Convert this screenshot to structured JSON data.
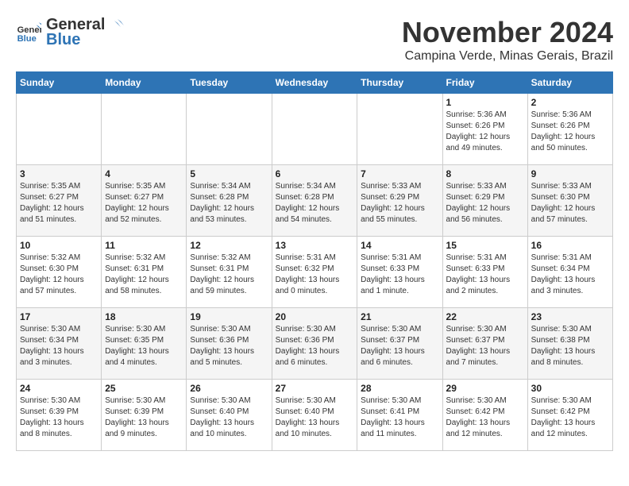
{
  "header": {
    "logo_line1": "General",
    "logo_line2": "Blue",
    "month": "November 2024",
    "location": "Campina Verde, Minas Gerais, Brazil"
  },
  "weekdays": [
    "Sunday",
    "Monday",
    "Tuesday",
    "Wednesday",
    "Thursday",
    "Friday",
    "Saturday"
  ],
  "weeks": [
    [
      {
        "day": "",
        "info": ""
      },
      {
        "day": "",
        "info": ""
      },
      {
        "day": "",
        "info": ""
      },
      {
        "day": "",
        "info": ""
      },
      {
        "day": "",
        "info": ""
      },
      {
        "day": "1",
        "info": "Sunrise: 5:36 AM\nSunset: 6:26 PM\nDaylight: 12 hours and 49 minutes."
      },
      {
        "day": "2",
        "info": "Sunrise: 5:36 AM\nSunset: 6:26 PM\nDaylight: 12 hours and 50 minutes."
      }
    ],
    [
      {
        "day": "3",
        "info": "Sunrise: 5:35 AM\nSunset: 6:27 PM\nDaylight: 12 hours and 51 minutes."
      },
      {
        "day": "4",
        "info": "Sunrise: 5:35 AM\nSunset: 6:27 PM\nDaylight: 12 hours and 52 minutes."
      },
      {
        "day": "5",
        "info": "Sunrise: 5:34 AM\nSunset: 6:28 PM\nDaylight: 12 hours and 53 minutes."
      },
      {
        "day": "6",
        "info": "Sunrise: 5:34 AM\nSunset: 6:28 PM\nDaylight: 12 hours and 54 minutes."
      },
      {
        "day": "7",
        "info": "Sunrise: 5:33 AM\nSunset: 6:29 PM\nDaylight: 12 hours and 55 minutes."
      },
      {
        "day": "8",
        "info": "Sunrise: 5:33 AM\nSunset: 6:29 PM\nDaylight: 12 hours and 56 minutes."
      },
      {
        "day": "9",
        "info": "Sunrise: 5:33 AM\nSunset: 6:30 PM\nDaylight: 12 hours and 57 minutes."
      }
    ],
    [
      {
        "day": "10",
        "info": "Sunrise: 5:32 AM\nSunset: 6:30 PM\nDaylight: 12 hours and 57 minutes."
      },
      {
        "day": "11",
        "info": "Sunrise: 5:32 AM\nSunset: 6:31 PM\nDaylight: 12 hours and 58 minutes."
      },
      {
        "day": "12",
        "info": "Sunrise: 5:32 AM\nSunset: 6:31 PM\nDaylight: 12 hours and 59 minutes."
      },
      {
        "day": "13",
        "info": "Sunrise: 5:31 AM\nSunset: 6:32 PM\nDaylight: 13 hours and 0 minutes."
      },
      {
        "day": "14",
        "info": "Sunrise: 5:31 AM\nSunset: 6:33 PM\nDaylight: 13 hours and 1 minute."
      },
      {
        "day": "15",
        "info": "Sunrise: 5:31 AM\nSunset: 6:33 PM\nDaylight: 13 hours and 2 minutes."
      },
      {
        "day": "16",
        "info": "Sunrise: 5:31 AM\nSunset: 6:34 PM\nDaylight: 13 hours and 3 minutes."
      }
    ],
    [
      {
        "day": "17",
        "info": "Sunrise: 5:30 AM\nSunset: 6:34 PM\nDaylight: 13 hours and 3 minutes."
      },
      {
        "day": "18",
        "info": "Sunrise: 5:30 AM\nSunset: 6:35 PM\nDaylight: 13 hours and 4 minutes."
      },
      {
        "day": "19",
        "info": "Sunrise: 5:30 AM\nSunset: 6:36 PM\nDaylight: 13 hours and 5 minutes."
      },
      {
        "day": "20",
        "info": "Sunrise: 5:30 AM\nSunset: 6:36 PM\nDaylight: 13 hours and 6 minutes."
      },
      {
        "day": "21",
        "info": "Sunrise: 5:30 AM\nSunset: 6:37 PM\nDaylight: 13 hours and 6 minutes."
      },
      {
        "day": "22",
        "info": "Sunrise: 5:30 AM\nSunset: 6:37 PM\nDaylight: 13 hours and 7 minutes."
      },
      {
        "day": "23",
        "info": "Sunrise: 5:30 AM\nSunset: 6:38 PM\nDaylight: 13 hours and 8 minutes."
      }
    ],
    [
      {
        "day": "24",
        "info": "Sunrise: 5:30 AM\nSunset: 6:39 PM\nDaylight: 13 hours and 8 minutes."
      },
      {
        "day": "25",
        "info": "Sunrise: 5:30 AM\nSunset: 6:39 PM\nDaylight: 13 hours and 9 minutes."
      },
      {
        "day": "26",
        "info": "Sunrise: 5:30 AM\nSunset: 6:40 PM\nDaylight: 13 hours and 10 minutes."
      },
      {
        "day": "27",
        "info": "Sunrise: 5:30 AM\nSunset: 6:40 PM\nDaylight: 13 hours and 10 minutes."
      },
      {
        "day": "28",
        "info": "Sunrise: 5:30 AM\nSunset: 6:41 PM\nDaylight: 13 hours and 11 minutes."
      },
      {
        "day": "29",
        "info": "Sunrise: 5:30 AM\nSunset: 6:42 PM\nDaylight: 13 hours and 12 minutes."
      },
      {
        "day": "30",
        "info": "Sunrise: 5:30 AM\nSunset: 6:42 PM\nDaylight: 13 hours and 12 minutes."
      }
    ]
  ]
}
